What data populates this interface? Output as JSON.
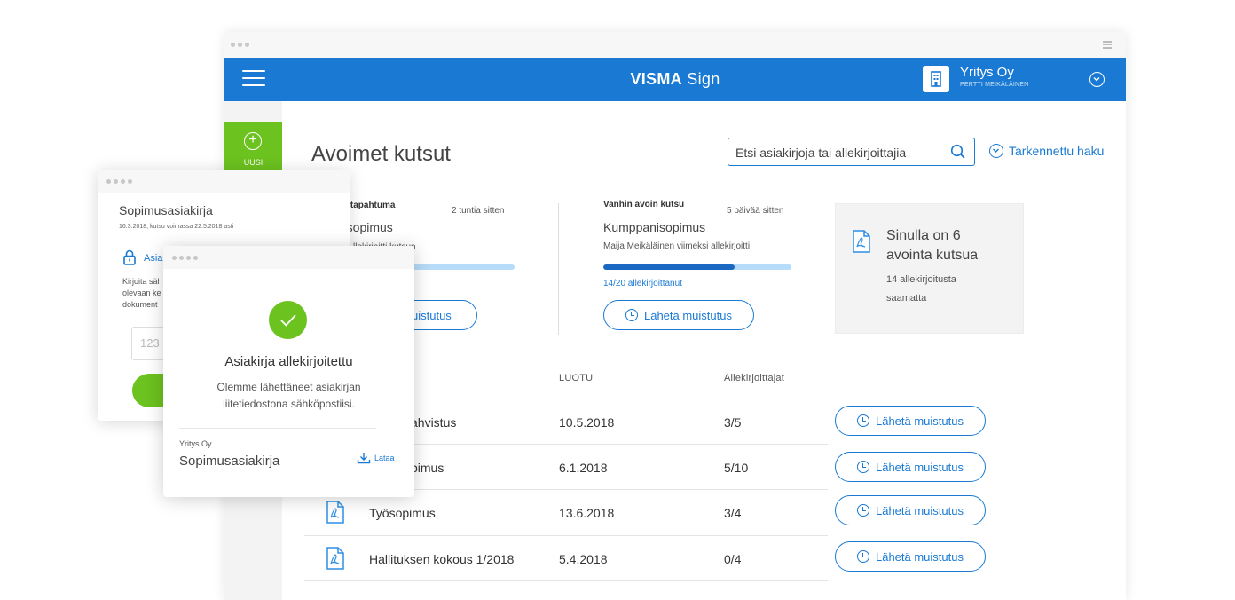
{
  "colors": {
    "primary": "#1a7ad3",
    "accent_green": "#6cc21f",
    "pdf_icon": "#2d8fe6"
  },
  "header": {
    "brand_bold": "VISMA",
    "brand_light": " Sign",
    "company_name": "Yritys Oy",
    "company_user": "PERTTI MEIKÄLÄINEN"
  },
  "sidebar": {
    "new_label": "UUSI"
  },
  "main": {
    "title": "Avoimet kutsut",
    "search_placeholder": "Etsi asiakirjoja tai allekirjoittajia",
    "advanced_search": "Tarkennettu haku"
  },
  "card_latest": {
    "heading": "n tapahtuma",
    "time": "2 tuntia sitten",
    "doc": "-sopimus",
    "sub": "llekirjoitti kutsun",
    "progress": 0.35,
    "remind": "uistutus"
  },
  "card_oldest": {
    "heading": "Vanhin avoin kutsu",
    "time": "5 päivää sitten",
    "doc": "Kumppanisopimus",
    "sub": "Maija Meikäläinen viimeksi allekirjoitti",
    "progress": 0.7,
    "progress_label": "14/20 allekirjoittanut",
    "remind": "Lähetä muistutus"
  },
  "summary": {
    "line1": "Sinulla on 6",
    "line2": "avointa kutsua",
    "small1": "14 allekirjoitusta",
    "small2": "saamatta"
  },
  "table": {
    "col_created": "LUOTU",
    "col_signers": "Allekirjoittajat",
    "rows": [
      {
        "name": "ahvistus",
        "created": "10.5.2018",
        "signers": "3/5",
        "action": "Lähetä muistutus"
      },
      {
        "name": "pimus",
        "created": "6.1.2018",
        "signers": "5/10",
        "action": "Lähetä muistutus"
      },
      {
        "name": "Työsopimus",
        "created": "13.6.2018",
        "signers": "3/4",
        "action": "Lähetä muistutus"
      },
      {
        "name": "Hallituksen kokous 1/2018",
        "created": "5.4.2018",
        "signers": "0/4",
        "action": "Lähetä muistutus"
      }
    ]
  },
  "window1": {
    "title": "Sopimusasiakirja",
    "date": "16.3.2018, kutsu voimassa 22.5.2018 asti",
    "sign_label": "Asia",
    "info1": "Kirjoita säh",
    "info2": "olevaan ke",
    "info3": "dokument",
    "code_placeholder": "123"
  },
  "window2": {
    "title": "Asiakirja allekirjoitettu",
    "desc1": "Olemme lähettäneet asiakirjan",
    "desc2": "liitetiedostona sähköpostiisi.",
    "company": "Yritys Oy",
    "doc": "Sopimusasiakirja",
    "download": "Lataa"
  }
}
